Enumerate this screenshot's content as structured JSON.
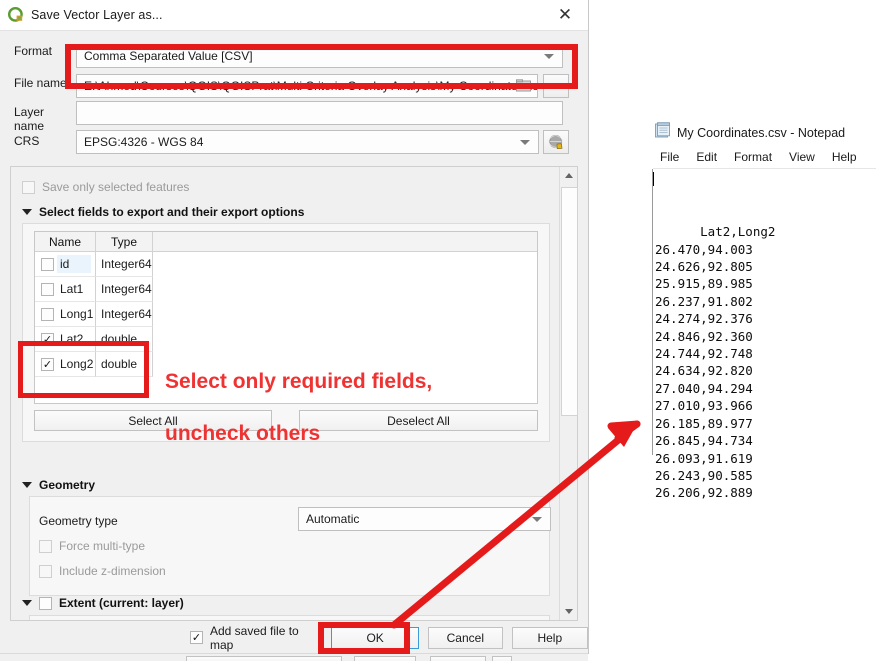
{
  "dialog": {
    "title": "Save Vector Layer as...",
    "icon": "qgis-logo-icon",
    "close_label": "✕",
    "fields": {
      "format_label": "Format",
      "format_value": "Comma Separated Value [CSV]",
      "filename_label": "File name",
      "filename_value": "E:\\Ahmed\\Courses\\QGIS\\QGISPrat\\Multi Criteria Overlay Analysis\\My Coordinates.csv",
      "browse_label": "...",
      "layername_label": "Layer name",
      "layername_value": "",
      "crs_label": "CRS",
      "crs_value": "EPSG:4326 - WGS 84"
    },
    "save_only_selected": {
      "label": "Save only selected features",
      "checked": false,
      "enabled": false
    },
    "select_fields_section": {
      "title": "Select fields to export and their export options",
      "expanded": true,
      "table": {
        "headers": [
          "Name",
          "Type"
        ],
        "rows": [
          {
            "checked": false,
            "name": "id",
            "type": "Integer64"
          },
          {
            "checked": false,
            "name": "Lat1",
            "type": "Integer64"
          },
          {
            "checked": false,
            "name": "Long1",
            "type": "Integer64"
          },
          {
            "checked": true,
            "name": "Lat2",
            "type": "double"
          },
          {
            "checked": true,
            "name": "Long2",
            "type": "double"
          }
        ]
      },
      "select_all_label": "Select All",
      "deselect_all_label": "Deselect All"
    },
    "geometry_section": {
      "title": "Geometry",
      "expanded": true,
      "geometry_type_label": "Geometry type",
      "geometry_type_value": "Automatic",
      "force_multi_label": "Force multi-type",
      "force_multi_checked": false,
      "include_z_label": "Include z-dimension",
      "include_z_checked": false
    },
    "extent_section": {
      "title": "Extent (current: layer)",
      "checked": false,
      "expanded": true
    },
    "footer": {
      "add_saved_label": "Add saved file to map",
      "add_saved_checked": true,
      "ok_label": "OK",
      "cancel_label": "Cancel",
      "help_label": "Help"
    }
  },
  "annotations": {
    "color": "#ef3232",
    "note_line1": "Select only required fields,",
    "note_line2": "uncheck others",
    "arrow_name": "red-arrow-annotation"
  },
  "notepad": {
    "icon": "notepad-icon",
    "title": "My Coordinates.csv - Notepad",
    "menu": [
      "File",
      "Edit",
      "Format",
      "View",
      "Help"
    ],
    "content_header": "Lat2,Long2",
    "content_lines": [
      "26.470,94.003",
      "24.626,92.805",
      "25.915,89.985",
      "26.237,91.802",
      "24.274,92.376",
      "24.846,92.360",
      "24.744,92.748",
      "24.634,92.820",
      "27.040,94.294",
      "27.010,93.966",
      "26.185,89.977",
      "26.845,94.734",
      "26.093,91.619",
      "26.243,90.585",
      "26.206,92.889"
    ]
  }
}
